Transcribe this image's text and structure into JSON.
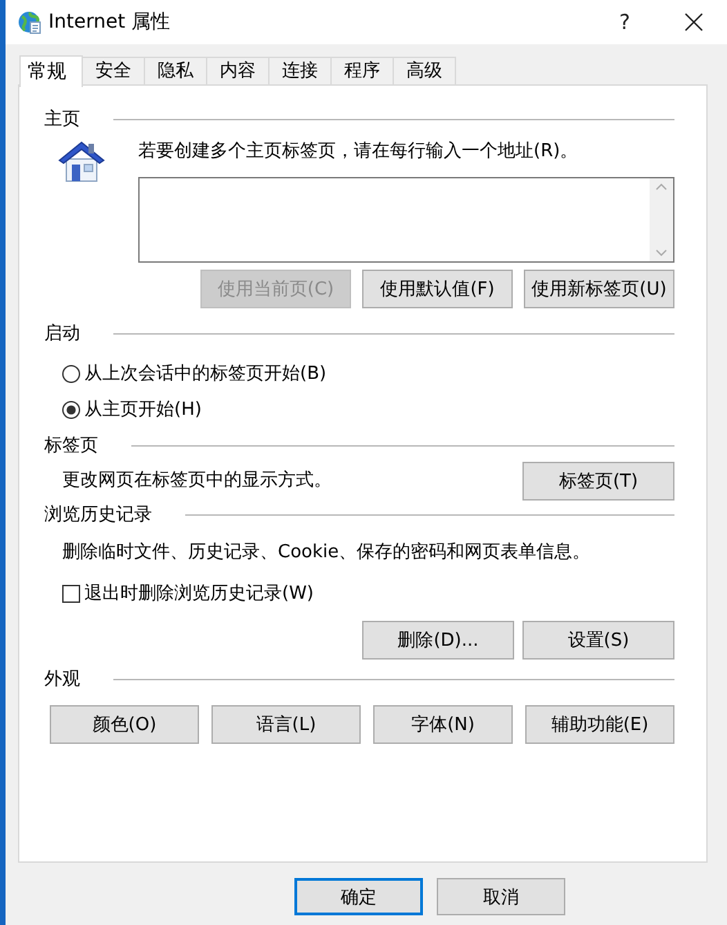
{
  "window": {
    "title": "Internet 属性",
    "help_button": "?"
  },
  "tabs": [
    {
      "label": "常规",
      "selected": true
    },
    {
      "label": "安全",
      "selected": false
    },
    {
      "label": "隐私",
      "selected": false
    },
    {
      "label": "内容",
      "selected": false
    },
    {
      "label": "连接",
      "selected": false
    },
    {
      "label": "程序",
      "selected": false
    },
    {
      "label": "高级",
      "selected": false
    }
  ],
  "homepage": {
    "heading": "主页",
    "instruction": "若要创建多个主页标签页，请在每行输入一个地址(R)。",
    "buttons": [
      {
        "label": "使用当前页(C)",
        "disabled": true
      },
      {
        "label": "使用默认值(F)",
        "disabled": false
      },
      {
        "label": "使用新标签页(U)",
        "disabled": false
      }
    ]
  },
  "startup": {
    "heading": "启动",
    "options": [
      {
        "label": "从上次会话中的标签页开始(B)",
        "selected": false
      },
      {
        "label": "从主页开始(H)",
        "selected": true
      }
    ]
  },
  "tab_settings": {
    "heading": "标签页",
    "description": "更改网页在标签页中的显示方式。",
    "button": "标签页(T)"
  },
  "history": {
    "heading": "浏览历史记录",
    "description": "删除临时文件、历史记录、Cookie、保存的密码和网页表单信息。",
    "checkbox": {
      "label": "退出时删除浏览历史记录(W)",
      "checked": false
    },
    "buttons": [
      "删除(D)...",
      "设置(S)"
    ]
  },
  "appearance": {
    "heading": "外观",
    "buttons": [
      "颜色(O)",
      "语言(L)",
      "字体(N)",
      "辅助功能(E)"
    ]
  },
  "footer_buttons": [
    {
      "label": "确定",
      "default": true
    },
    {
      "label": "取消",
      "default": false
    }
  ]
}
